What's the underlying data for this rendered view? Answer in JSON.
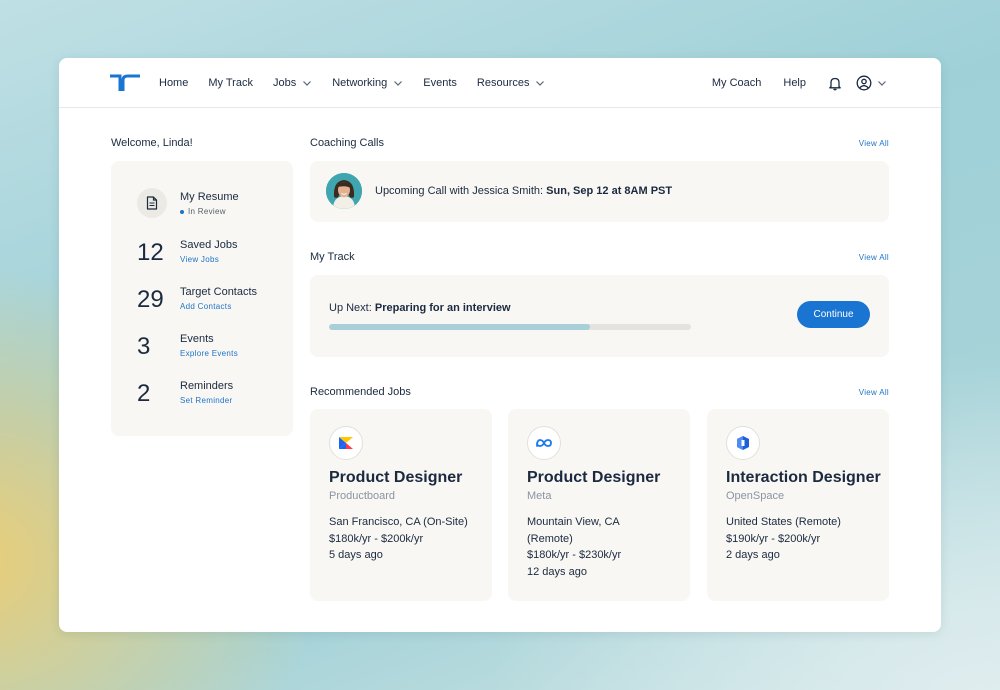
{
  "nav": {
    "logo_icon": "tr-logo-icon",
    "links": [
      {
        "label": "Home"
      },
      {
        "label": "My Track"
      },
      {
        "label": "Jobs",
        "dropdown": true
      },
      {
        "label": "Networking",
        "dropdown": true
      },
      {
        "label": "Events"
      },
      {
        "label": "Resources",
        "dropdown": true
      }
    ],
    "my_coach": "My Coach",
    "help": "Help",
    "bell_icon": "bell-icon",
    "account_icon": "user-circle-icon"
  },
  "welcome": "Welcome, Linda!",
  "stats": {
    "resume": {
      "title": "My Resume",
      "status": "In Review",
      "icon": "document-icon"
    },
    "saved_jobs": {
      "count": "12",
      "title": "Saved Jobs",
      "link": "View Jobs"
    },
    "target_contacts": {
      "count": "29",
      "title": "Target Contacts",
      "link": "Add Contacts"
    },
    "events": {
      "count": "3",
      "title": "Events",
      "link": "Explore Events"
    },
    "reminders": {
      "count": "2",
      "title": "Reminders",
      "link": "Set Reminder"
    }
  },
  "coaching": {
    "title": "Coaching Calls",
    "view_all": "View All",
    "call_prefix": "Upcoming Call with Jessica Smith: ",
    "call_time": "Sun, Sep 12 at 8AM PST"
  },
  "track": {
    "title": "My Track",
    "view_all": "View All",
    "prefix": "Up Next: ",
    "next_step": "Preparing for an interview",
    "progress": 0.72,
    "button": "Continue"
  },
  "jobs": {
    "title": "Recommended Jobs",
    "view_all": "View All",
    "items": [
      {
        "title": "Product Designer",
        "company": "Productboard",
        "location": "San Francisco, CA (On-Site)",
        "salary": "$180k/yr - $200k/yr",
        "posted": "5 days ago",
        "logo": "productboard-logo-icon"
      },
      {
        "title": "Product Designer",
        "company": "Meta",
        "location": "Mountain View, CA (Remote)",
        "salary": "$180k/yr - $230k/yr",
        "posted": "12 days ago",
        "logo": "meta-logo-icon"
      },
      {
        "title": "Interaction Designer",
        "company": "OpenSpace",
        "location": "United States (Remote)",
        "salary": "$190k/yr - $200k/yr",
        "posted": "2 days ago",
        "logo": "openspace-logo-icon"
      }
    ]
  },
  "colors": {
    "accent": "#1a74d2",
    "card_bg": "#f8f7f4",
    "text": "#1b2a3f"
  }
}
